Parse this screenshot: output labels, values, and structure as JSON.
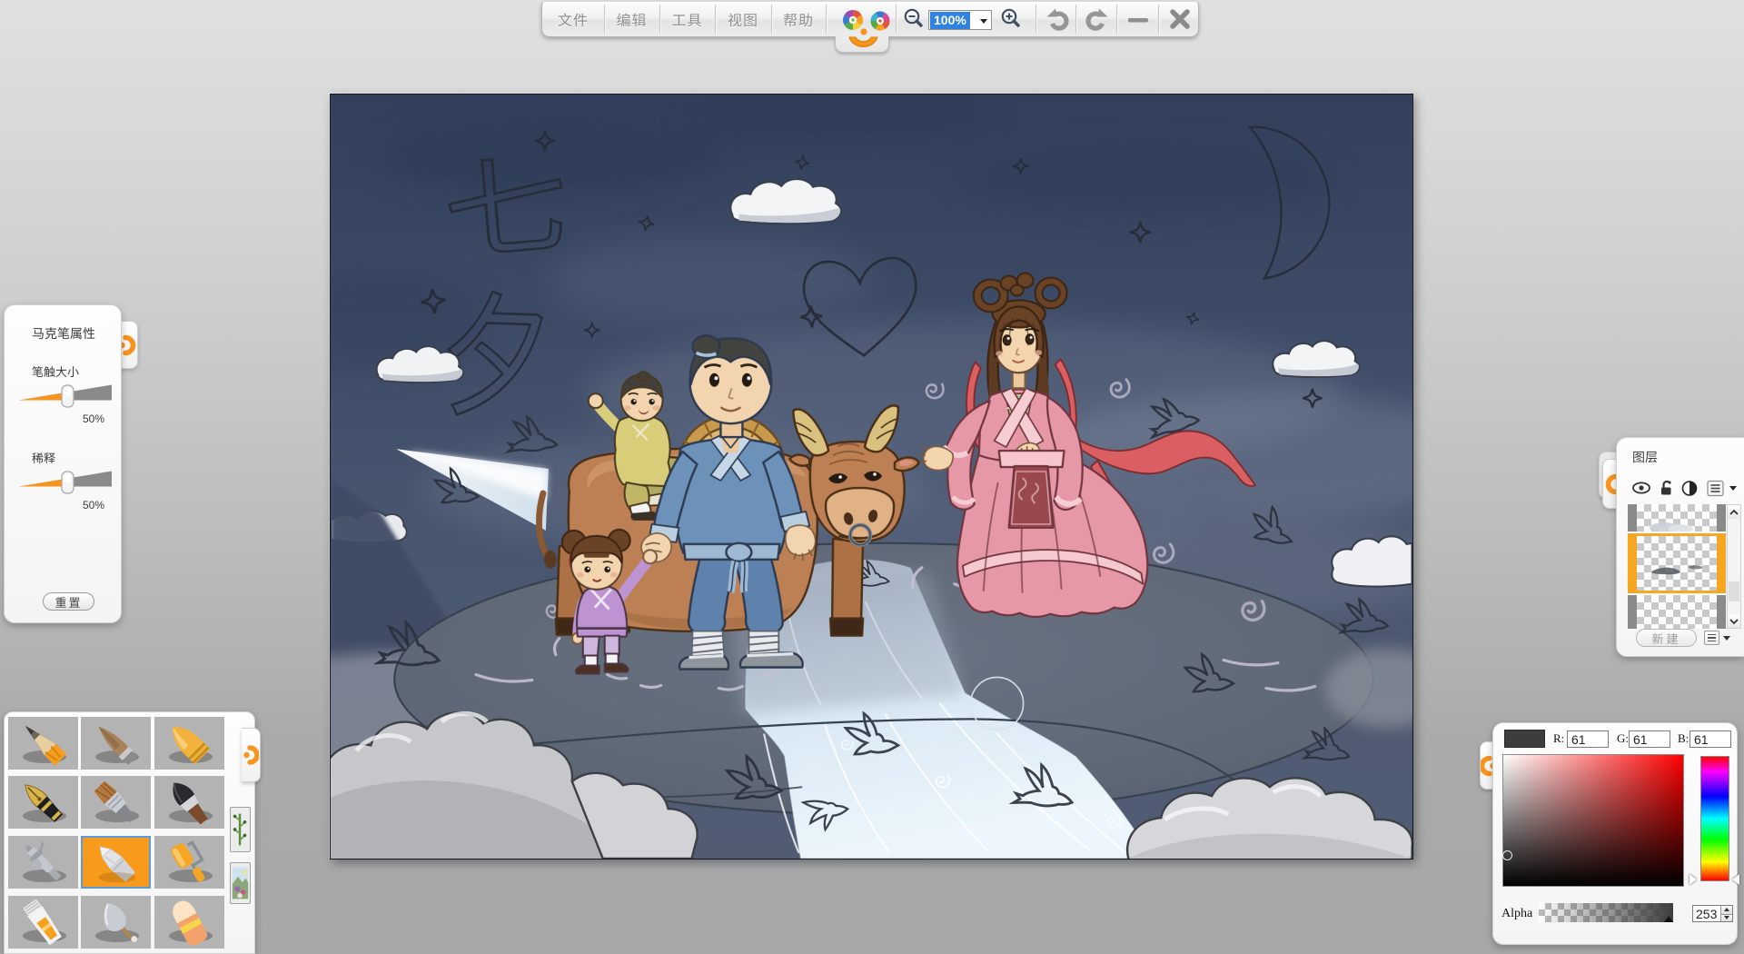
{
  "colors": {
    "accent_orange": "#f7941d",
    "selection_blue": "#2f82e1",
    "layer_highlight": "#f7a623",
    "current_color": "#3d3d3d"
  },
  "toolbar": {
    "menus": [
      {
        "label": "文件"
      },
      {
        "label": "编辑"
      },
      {
        "label": "工具"
      },
      {
        "label": "视图"
      },
      {
        "label": "帮助"
      }
    ],
    "zoom_value": "100%"
  },
  "marker_panel": {
    "title": "马克笔属性",
    "sliders": [
      {
        "label": "笔触大小",
        "value": "50%"
      },
      {
        "label": "稀释",
        "value": "50%"
      }
    ],
    "reset_label": "重置"
  },
  "layers_panel": {
    "title": "图层",
    "new_label": "新建"
  },
  "color_panel": {
    "r_label": "R:",
    "r_value": "61",
    "g_label": "G:",
    "g_value": "61",
    "b_label": "B:",
    "b_value": "61",
    "alpha_label": "Alpha",
    "alpha_value": "253"
  },
  "canvas_art": {
    "sketch_char_top": "七",
    "sketch_char_bottom": "夕"
  }
}
